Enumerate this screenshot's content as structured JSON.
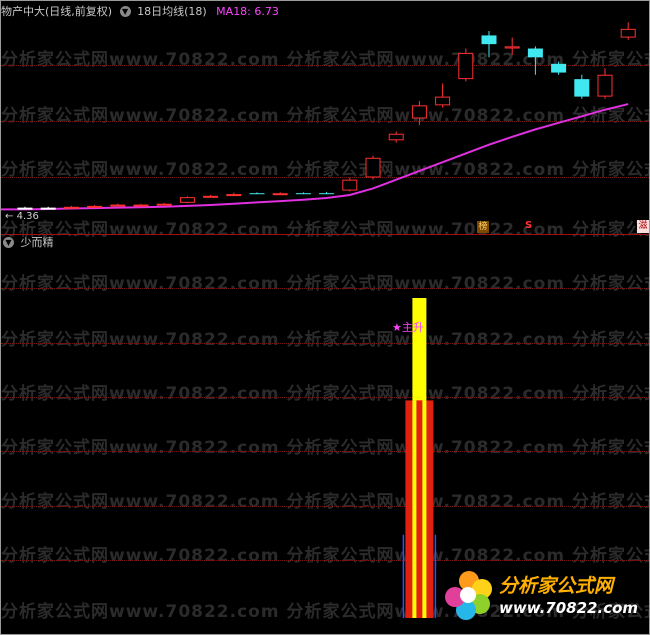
{
  "header": {
    "stock_label": "物产中大(日线,前复权)",
    "ma_period_label": "18日均线(18)",
    "ma_value_label": "MA18: 6.73"
  },
  "indicator": {
    "name": "少而精"
  },
  "watermark": {
    "text": "分析家公式网www.70822.com   分析家公式网www.70822.com   分析家公式网www.70822.com"
  },
  "price_label": "4.36",
  "markers": {
    "bang": "榜",
    "s": "S",
    "edge": "滋"
  },
  "signal": {
    "label": "★主升"
  },
  "logo": {
    "title": "分析家公式网",
    "url": "www.70822.com"
  },
  "colors": {
    "up": "#ff3030",
    "down": "#40e8f0",
    "ma": "#e030e0",
    "yellow": "#ffff00",
    "red": "#e02010"
  },
  "chart_data": {
    "type": "candlestick",
    "candles": [
      {
        "o": 4.36,
        "c": 4.36,
        "h": 4.38,
        "l": 4.34,
        "dir": "doji"
      },
      {
        "o": 4.36,
        "c": 4.36,
        "h": 4.38,
        "l": 4.34,
        "dir": "doji"
      },
      {
        "o": 4.35,
        "c": 4.38,
        "h": 4.4,
        "l": 4.34,
        "dir": "up"
      },
      {
        "o": 4.38,
        "c": 4.4,
        "h": 4.42,
        "l": 4.37,
        "dir": "up"
      },
      {
        "o": 4.41,
        "c": 4.43,
        "h": 4.45,
        "l": 4.4,
        "dir": "up"
      },
      {
        "o": 4.43,
        "c": 4.43,
        "h": 4.45,
        "l": 4.41,
        "dir": "up"
      },
      {
        "o": 4.43,
        "c": 4.45,
        "h": 4.47,
        "l": 4.42,
        "dir": "up"
      },
      {
        "o": 4.47,
        "c": 4.6,
        "h": 4.62,
        "l": 4.46,
        "dir": "up"
      },
      {
        "o": 4.6,
        "c": 4.63,
        "h": 4.65,
        "l": 4.59,
        "dir": "up"
      },
      {
        "o": 4.64,
        "c": 4.67,
        "h": 4.7,
        "l": 4.63,
        "dir": "up"
      },
      {
        "o": 4.69,
        "c": 4.69,
        "h": 4.71,
        "l": 4.67,
        "dir": "down"
      },
      {
        "o": 4.69,
        "c": 4.69,
        "h": 4.71,
        "l": 4.67,
        "dir": "up"
      },
      {
        "o": 4.69,
        "c": 4.69,
        "h": 4.71,
        "l": 4.67,
        "dir": "down"
      },
      {
        "o": 4.69,
        "c": 4.69,
        "h": 4.72,
        "l": 4.67,
        "dir": "down"
      },
      {
        "o": 4.75,
        "c": 5.0,
        "h": 5.05,
        "l": 4.73,
        "dir": "up"
      },
      {
        "o": 5.05,
        "c": 5.5,
        "h": 5.55,
        "l": 5.0,
        "dir": "up"
      },
      {
        "o": 5.9,
        "c": 6.05,
        "h": 6.1,
        "l": 5.85,
        "dir": "up"
      },
      {
        "o": 6.4,
        "c": 6.7,
        "h": 6.8,
        "l": 6.25,
        "dir": "up"
      },
      {
        "o": 6.7,
        "c": 6.9,
        "h": 7.2,
        "l": 6.65,
        "dir": "up"
      },
      {
        "o": 7.3,
        "c": 7.9,
        "h": 8.0,
        "l": 7.25,
        "dir": "up"
      },
      {
        "o": 8.3,
        "c": 8.1,
        "h": 8.4,
        "l": 7.8,
        "dir": "down"
      },
      {
        "o": 8.0,
        "c": 8.05,
        "h": 8.25,
        "l": 7.85,
        "dir": "up"
      },
      {
        "o": 8.0,
        "c": 7.8,
        "h": 8.05,
        "l": 7.4,
        "dir": "down"
      },
      {
        "o": 7.65,
        "c": 7.45,
        "h": 7.7,
        "l": 7.4,
        "dir": "down"
      },
      {
        "o": 7.3,
        "c": 6.9,
        "h": 7.4,
        "l": 6.85,
        "dir": "down"
      },
      {
        "o": 6.9,
        "c": 7.4,
        "h": 7.55,
        "l": 6.85,
        "dir": "up"
      },
      {
        "o": 8.25,
        "c": 8.45,
        "h": 8.6,
        "l": 8.2,
        "dir": "up"
      }
    ],
    "ma18": [
      4.32,
      4.33,
      4.34,
      4.35,
      4.36,
      4.37,
      4.38,
      4.4,
      4.42,
      4.45,
      4.48,
      4.51,
      4.54,
      4.58,
      4.65,
      4.8,
      5.0,
      5.2,
      5.4,
      5.6,
      5.8,
      5.98,
      6.15,
      6.3,
      6.45,
      6.6,
      6.73
    ],
    "ylim": [
      4.1,
      8.95
    ],
    "indicator_bars": [
      {
        "index": 17,
        "low": 0.0,
        "yellow_top": 1.0,
        "red_top": 0.68,
        "blue_top": 0.26
      }
    ]
  }
}
